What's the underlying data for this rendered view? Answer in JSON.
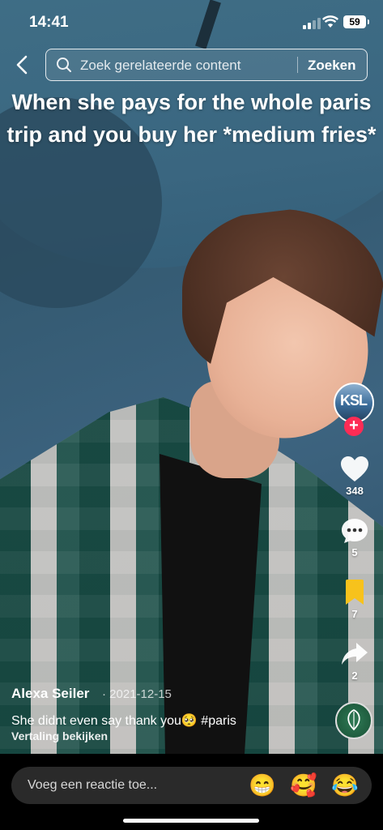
{
  "status_bar": {
    "time": "14:41",
    "battery": "59"
  },
  "search": {
    "placeholder": "Zoek gerelateerde content",
    "button": "Zoeken"
  },
  "overlay_caption": "When she pays for the whole paris trip and you buy her  *medium fries*",
  "rail": {
    "likes": "348",
    "comments": "5",
    "saves": "7",
    "shares": "2",
    "avatar_text": "KSL",
    "follow_symbol": "+"
  },
  "post": {
    "author": "Alexa Seiler",
    "date": "· 2021-12-15",
    "description": "She didnt even say thank you🥺 #paris",
    "translate": "Vertaling bekijken"
  },
  "comment_bar": {
    "placeholder": "Voeg een reactie toe...",
    "emojis": [
      "😁",
      "🥰",
      "😂"
    ]
  },
  "colors": {
    "accent": "#fe2c55",
    "save": "#f7c21c"
  }
}
